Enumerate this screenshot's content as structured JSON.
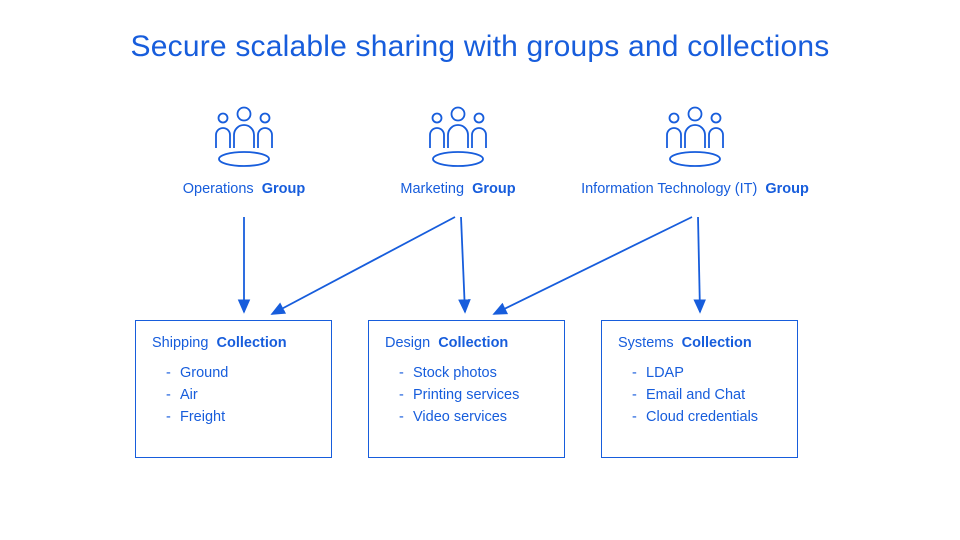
{
  "title": "Secure scalable sharing with groups and collections",
  "groups": [
    {
      "name": "Operations",
      "suffix": "Group"
    },
    {
      "name": "Marketing",
      "suffix": "Group"
    },
    {
      "name": "Information Technology (IT)",
      "suffix": "Group"
    }
  ],
  "collections": [
    {
      "name": "Shipping",
      "suffix": "Collection",
      "items": [
        "Ground",
        "Air",
        "Freight"
      ]
    },
    {
      "name": "Design",
      "suffix": "Collection",
      "items": [
        "Stock photos",
        "Printing services",
        "Video services"
      ]
    },
    {
      "name": "Systems",
      "suffix": "Collection",
      "items": [
        "LDAP",
        "Email and Chat",
        "Cloud credentials"
      ]
    }
  ],
  "connections": [
    {
      "from_group": 0,
      "to_collection": 0
    },
    {
      "from_group": 1,
      "to_collection": 0
    },
    {
      "from_group": 1,
      "to_collection": 1
    },
    {
      "from_group": 2,
      "to_collection": 1
    },
    {
      "from_group": 2,
      "to_collection": 2
    }
  ],
  "chart_data": {
    "type": "diagram",
    "nodes": [
      {
        "id": "g0",
        "kind": "group",
        "label": "Operations Group"
      },
      {
        "id": "g1",
        "kind": "group",
        "label": "Marketing Group"
      },
      {
        "id": "g2",
        "kind": "group",
        "label": "Information Technology (IT) Group"
      },
      {
        "id": "c0",
        "kind": "collection",
        "label": "Shipping Collection",
        "items": [
          "Ground",
          "Air",
          "Freight"
        ]
      },
      {
        "id": "c1",
        "kind": "collection",
        "label": "Design Collection",
        "items": [
          "Stock photos",
          "Printing services",
          "Video services"
        ]
      },
      {
        "id": "c2",
        "kind": "collection",
        "label": "Systems Collection",
        "items": [
          "LDAP",
          "Email and Chat",
          "Cloud credentials"
        ]
      }
    ],
    "edges": [
      {
        "from": "g0",
        "to": "c0"
      },
      {
        "from": "g1",
        "to": "c0"
      },
      {
        "from": "g1",
        "to": "c1"
      },
      {
        "from": "g2",
        "to": "c1"
      },
      {
        "from": "g2",
        "to": "c2"
      }
    ],
    "title": "Secure scalable sharing with groups and collections"
  },
  "colors": {
    "primary": "#175ddc",
    "background": "#ffffff"
  }
}
